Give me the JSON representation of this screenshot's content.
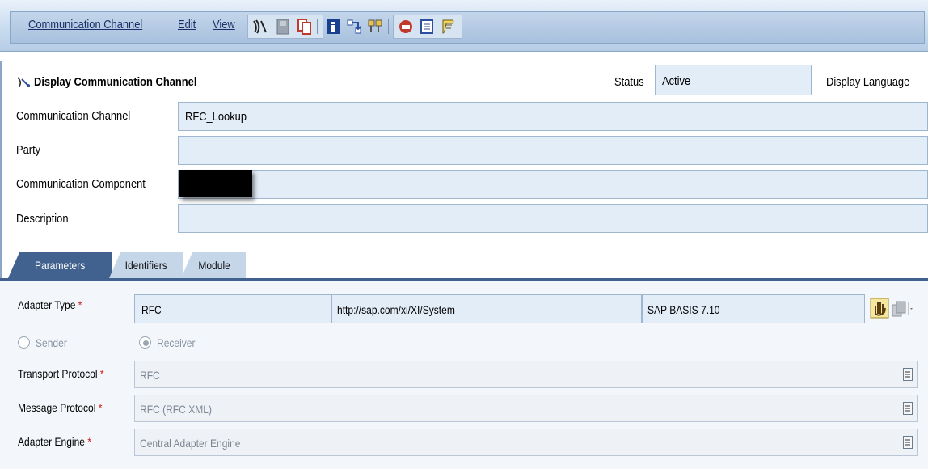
{
  "menu": {
    "items": [
      "Communication Channel",
      "Edit",
      "View"
    ],
    "toolbar_icons": [
      "edit-icon",
      "save-icon",
      "copy-icon",
      "info-icon",
      "where-used-icon",
      "compare-icon",
      "channel-monitor-icon",
      "properties-icon",
      "notes-icon"
    ]
  },
  "header": {
    "title": "Display Communication Channel",
    "status_label": "Status",
    "status_value": "Active",
    "display_language_label": "Display Language"
  },
  "form": {
    "channel_label": "Communication Channel",
    "channel_value": "RFC_Lookup",
    "party_label": "Party",
    "party_value": "",
    "component_label": "Communication Component",
    "component_value": "",
    "description_label": "Description",
    "description_value": ""
  },
  "tabs": [
    "Parameters",
    "Identifiers",
    "Module"
  ],
  "parameters": {
    "adapter_type_label": "Adapter Type",
    "adapter_type_value": "RFC",
    "adapter_namespace": "http://sap.com/xi/XI/System",
    "adapter_swcv": "SAP BASIS 7.10",
    "sender_label": "Sender",
    "receiver_label": "Receiver",
    "transport_protocol_label": "Transport Protocol",
    "transport_protocol_value": "RFC",
    "message_protocol_label": "Message Protocol",
    "message_protocol_value": "RFC (RFC XML)",
    "adapter_engine_label": "Adapter Engine",
    "adapter_engine_value": "Central Adapter Engine",
    "required_marker": "*"
  },
  "colors": {
    "tab_active": "#41628f",
    "field_background": "#e3edf8",
    "required_star": "#d6201a"
  }
}
